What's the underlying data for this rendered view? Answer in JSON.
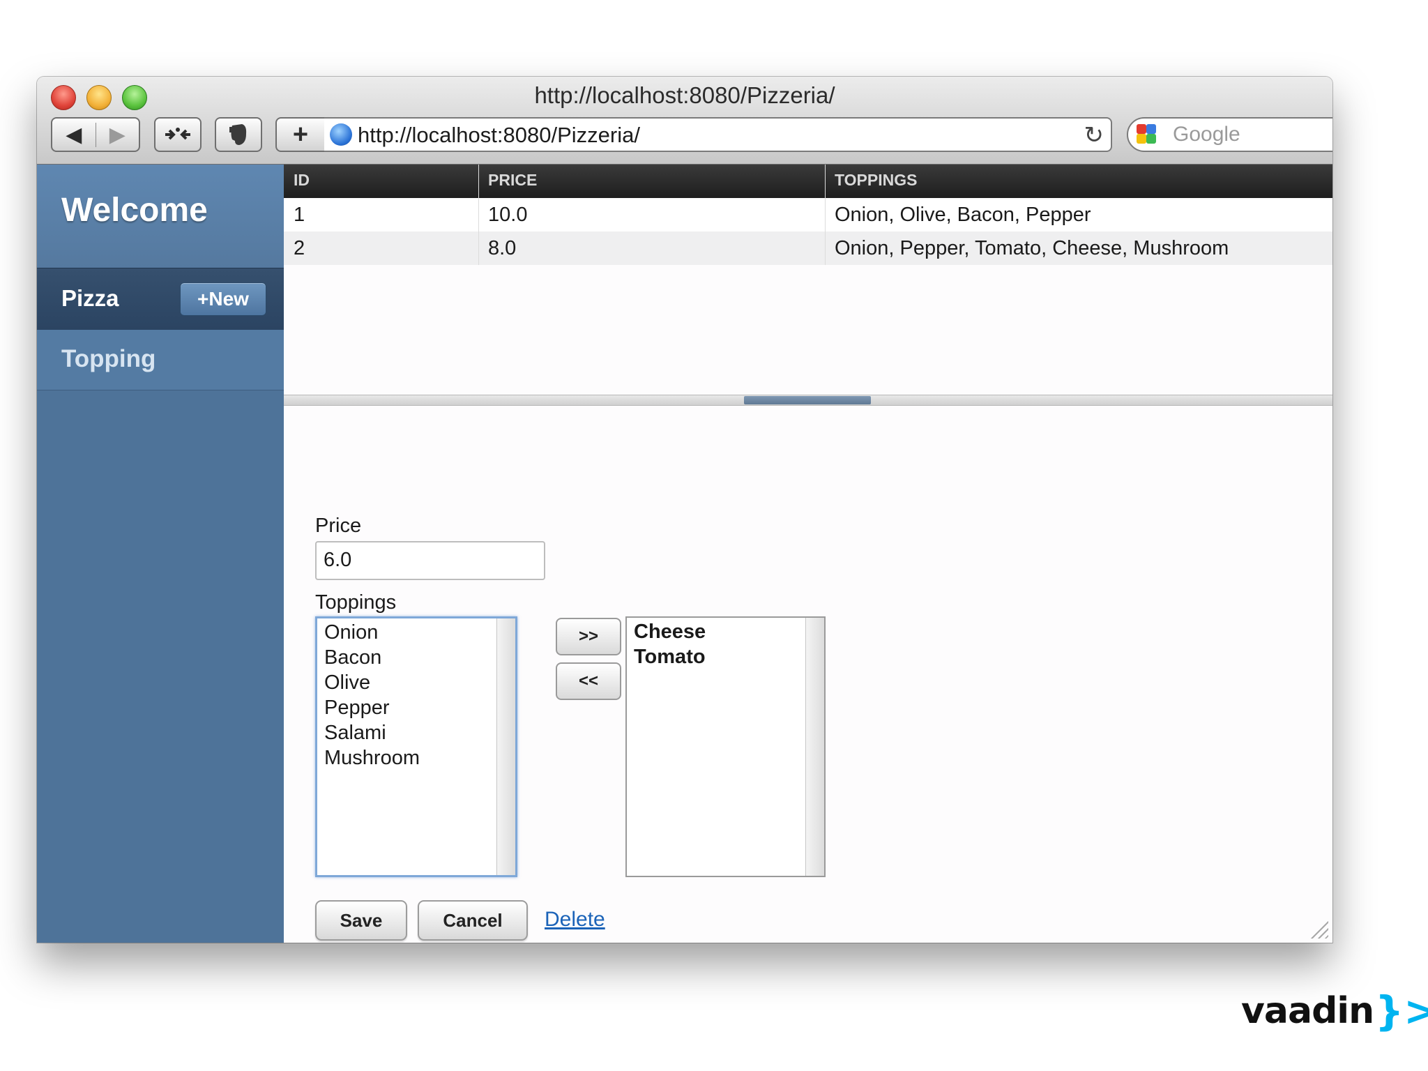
{
  "browser": {
    "window_title": "http://localhost:8080/Pizzeria/",
    "url": "http://localhost:8080/Pizzeria/",
    "search_placeholder": "Google",
    "back_glyph": "◀",
    "forward_glyph": "▶",
    "add_glyph": "+",
    "reload_glyph": "↻"
  },
  "sidebar": {
    "welcome": "Welcome",
    "items": [
      {
        "label": "Pizza",
        "selected": true
      },
      {
        "label": "Topping",
        "selected": false
      }
    ],
    "new_button_label": "+New"
  },
  "table": {
    "columns": [
      "ID",
      "PRICE",
      "TOPPINGS"
    ],
    "rows": [
      {
        "id": "1",
        "price": "10.0",
        "toppings": "Onion, Olive, Bacon, Pepper"
      },
      {
        "id": "2",
        "price": "8.0",
        "toppings": "Onion, Pepper, Tomato, Cheese, Mushroom"
      }
    ]
  },
  "form": {
    "price_label": "Price",
    "price_value": "6.0",
    "toppings_label": "Toppings",
    "available_toppings": [
      "Onion",
      "Bacon",
      "Olive",
      "Pepper",
      "Salami",
      "Mushroom"
    ],
    "selected_toppings": [
      "Cheese",
      "Tomato"
    ],
    "add_button_label": ">>",
    "remove_button_label": "<<",
    "save_label": "Save",
    "cancel_label": "Cancel",
    "delete_label": "Delete"
  },
  "branding": {
    "logo_text": "vaadin",
    "logo_mark": "}>",
    "accent_color": "#00b4f0"
  },
  "colors": {
    "sidebar": "#4e7399",
    "sidebar_selected": "#2f4866",
    "table_header": "#262626",
    "link": "#1b63b8"
  }
}
